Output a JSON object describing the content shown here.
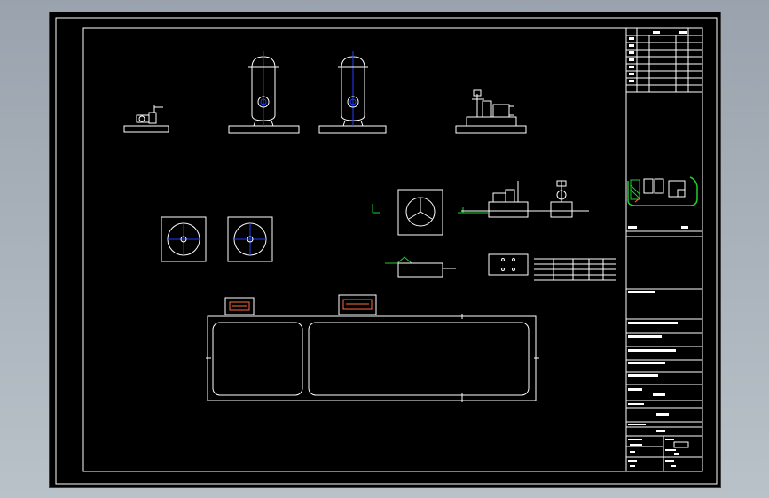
{
  "drawing": {
    "frame_color": "#ffffff",
    "background": "#000000",
    "accent_blue": "#1e3cff",
    "accent_green": "#22cc33",
    "accent_orange": "#ff6a3a"
  }
}
